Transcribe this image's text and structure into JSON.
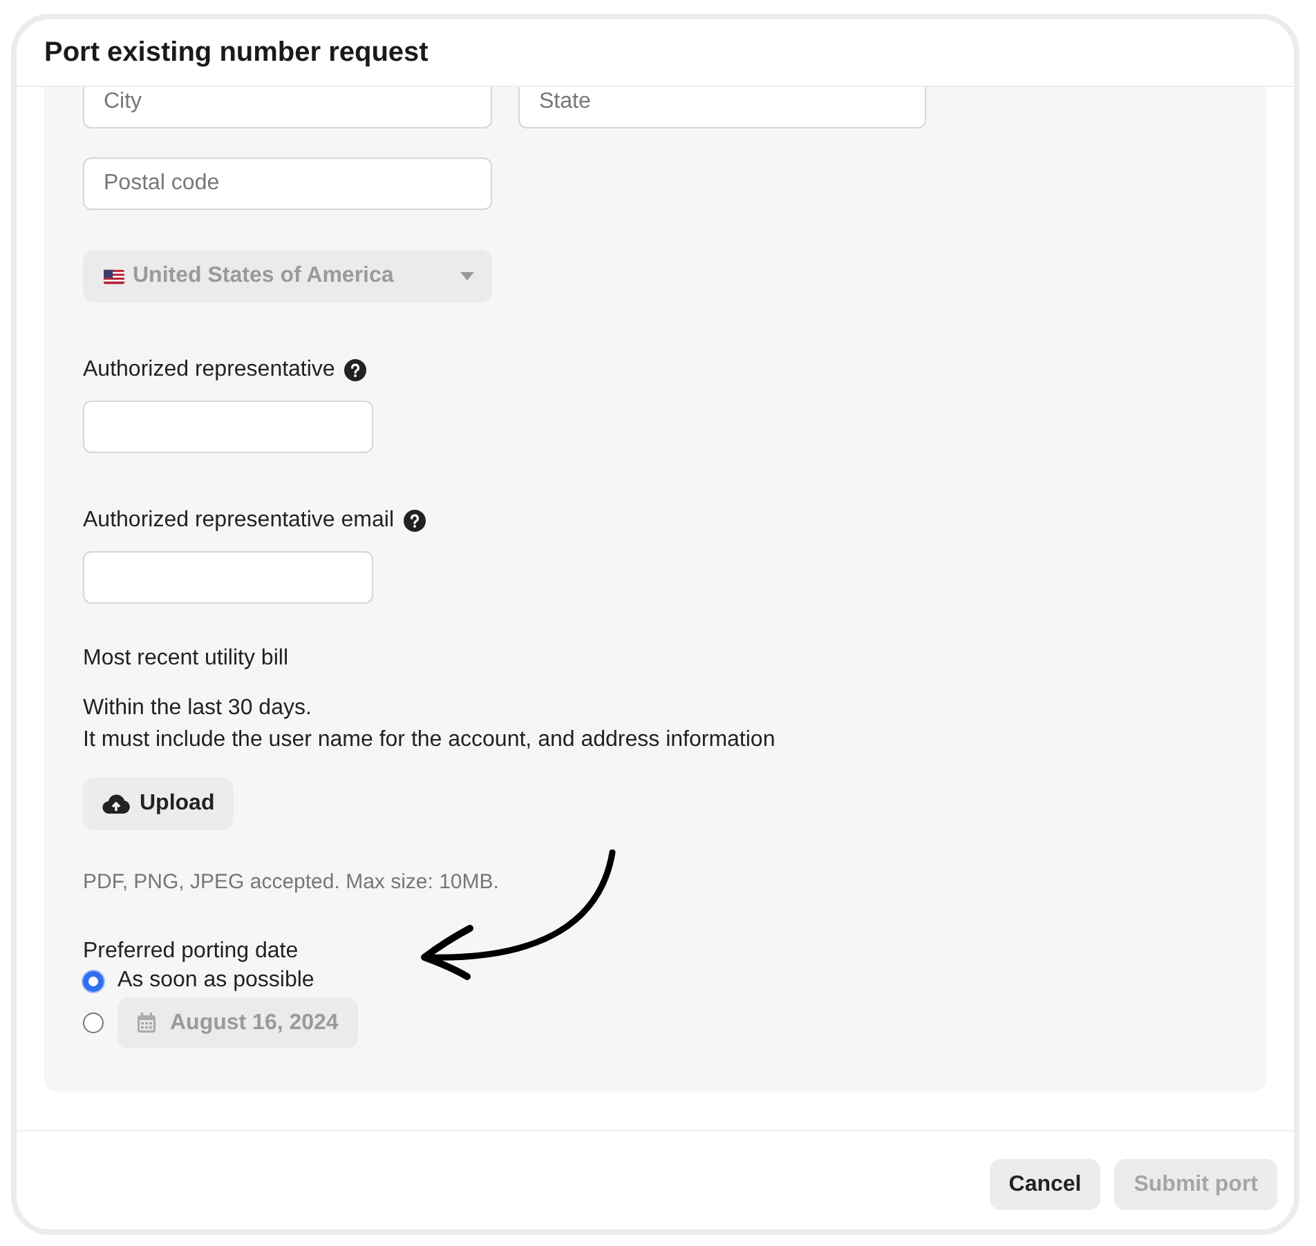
{
  "dialog": {
    "title": "Port existing number request"
  },
  "form": {
    "address_row": [
      {
        "placeholder": "City"
      },
      {
        "placeholder": "State"
      }
    ],
    "postal": {
      "placeholder": "Postal code"
    },
    "country": {
      "value": "United States of America",
      "disabled": true
    },
    "fields": [
      {
        "label": "Authorized representative",
        "help": true
      },
      {
        "label": "Authorized representative email",
        "help": true
      }
    ],
    "bill": {
      "label": "Most recent utility bill",
      "lines": [
        "Within the last 30 days.",
        "It must include the user name for the account, and address information"
      ],
      "upload": "Upload",
      "hint": "PDF, PNG, JPEG accepted. Max size: 10MB."
    },
    "porting": {
      "label": "Preferred porting date",
      "options": [
        {
          "kind": "text",
          "label": "As soon as possible",
          "selected": true
        },
        {
          "kind": "date",
          "label": "August 16, 2024",
          "selected": false,
          "disabled": true
        }
      ]
    }
  },
  "buttons": [
    {
      "label": "Cancel",
      "disabled": false
    },
    {
      "label": "Submit port",
      "disabled": true
    }
  ]
}
